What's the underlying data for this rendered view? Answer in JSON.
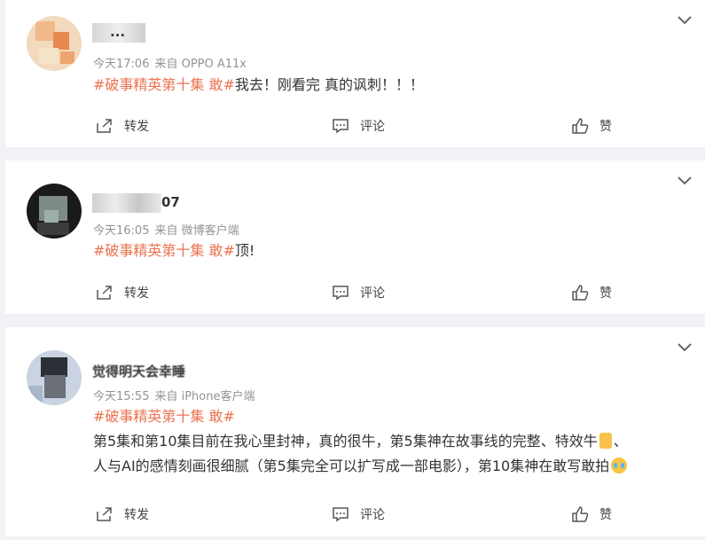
{
  "posts": [
    {
      "username_suffix": "...",
      "time": "今天17:06",
      "source": "来自 OPPO A11x",
      "tag": "#破事精英第十集 敢#",
      "content": "我去！刚看完 真的讽刺！！！",
      "actions": {
        "forward": "转发",
        "comment": "评论",
        "like": "赞"
      }
    },
    {
      "username_suffix": "07",
      "time": "今天16:05",
      "source": "来自 微博客户端",
      "tag": "#破事精英第十集 敢#",
      "content": "顶!",
      "actions": {
        "forward": "转发",
        "comment": "评论",
        "like": "赞"
      }
    },
    {
      "username_suffix": "觉得明天会幸睡",
      "time": "今天15:55",
      "source": "来自 iPhone客户端",
      "tag": "#破事精英第十集 敢#",
      "content_line1": "第5集和第10集目前在我心里封神，真的很牛，第5集神在故事线的完整、特效牛",
      "content_line1_tail": "、",
      "content_line2": "人与AI的感情刻画很细腻（第5集完全可以扩写成一部电影），第10集神在敢写敢拍",
      "actions": {
        "forward": "转发",
        "comment": "评论",
        "like": "赞"
      }
    }
  ],
  "icons": {
    "more": "chevron-down-icon",
    "forward": "forward-icon",
    "comment": "comment-icon",
    "like": "thumbs-up-icon",
    "emoji_beer": "beer-emoji-icon",
    "emoji_cry": "crying-emoji-icon"
  },
  "colors": {
    "tag": "#eb7350",
    "meta": "#939393",
    "background": "#f1f2f5"
  }
}
